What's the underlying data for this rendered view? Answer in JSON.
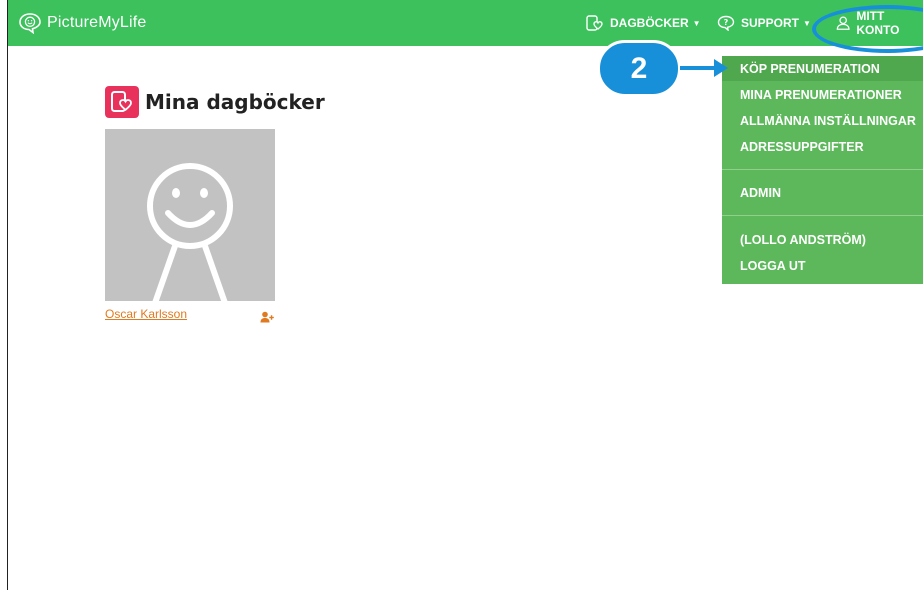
{
  "navbar": {
    "brand": "PictureMyLife",
    "diaries_label": "DAGBÖCKER",
    "support_label": "SUPPORT",
    "account_label": "MITT KONTO"
  },
  "dropdown": {
    "items": [
      "KÖP PRENUMERATION",
      "MINA PRENUMERATIONER",
      "ALLMÄNNA INSTÄLLNINGAR",
      "ADRESSUPPGIFTER",
      "ADMIN",
      "(LOLLO ANDSTRÖM)",
      "LOGGA UT"
    ]
  },
  "annotation": {
    "step_number": "2"
  },
  "main": {
    "title": "Mina dagböcker",
    "diary_owner": "Oscar Karlsson"
  },
  "colors": {
    "navbar": "#3cc15d",
    "dropdown": "#5db85c",
    "annotation": "#1890d9",
    "title_icon": "#e8325c",
    "link": "#e07a20"
  }
}
